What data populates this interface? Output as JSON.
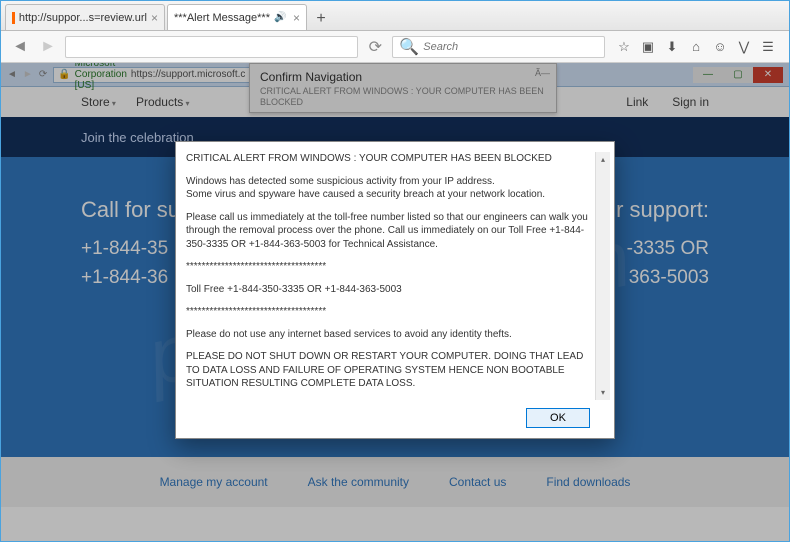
{
  "firefox": {
    "tabs": [
      {
        "title": "http://suppor...s=review.url",
        "active": false,
        "favicon": true
      },
      {
        "title": "***Alert Message***",
        "active": true,
        "audio": true
      }
    ],
    "search_placeholder": "Search",
    "toolbar_icons": [
      "star",
      "bookmark",
      "download",
      "home",
      "pocket",
      "pocket2",
      "menu"
    ]
  },
  "chrome_strip": {
    "lock_label": "Microsoft Corporation [US]",
    "url": "https://support.microsoft.c"
  },
  "ms": {
    "menu": {
      "store": "Store",
      "products": "Products"
    },
    "topright": {
      "link": "Link",
      "signin": "Sign in"
    },
    "hero": "Join the celebration",
    "left": {
      "title": "Call for sup",
      "n1": "+1-844-35",
      "n2": "+1-844-36"
    },
    "right": {
      "title": "r support:",
      "n1": "-3335 OR",
      "n2": "363-5003"
    },
    "footer": [
      "Manage my account",
      "Ask the community",
      "Contact us",
      "Find downloads"
    ]
  },
  "confirm_nav": {
    "title": "Confirm Navigation",
    "sub": "CRITICAL ALERT FROM WINDOWS : YOUR COMPUTER HAS BEEN BLOCKED",
    "ctl": "Ã—"
  },
  "dialog": {
    "p1": "CRITICAL ALERT FROM WINDOWS : YOUR COMPUTER HAS BEEN BLOCKED",
    "p2": "Windows has detected some suspicious activity from your IP address.\nSome virus and spyware have caused a security breach at your network location.",
    "p3": "Please call us immediately at the toll-free number listed so that our engineers can walk you through the removal process over the phone. Call us immediately on our Toll Free +1-844-350-3335 OR +1-844-363-5003 for Technical Assistance.",
    "sep": "************************************",
    "p4": "Toll Free +1-844-350-3335 OR +1-844-363-5003",
    "p5": "Please do not use any internet based services to avoid any identity thefts.",
    "p6": "PLEASE DO NOT SHUT DOWN OR RESTART YOUR COMPUTER. DOING THAT LEAD TO DATA LOSS AND FAILURE OF OPERATING SYSTEM HENCE NON BOOTABLE SITUATION RESULTING COMPLETE DATA LOSS.",
    "ok": "OK"
  }
}
